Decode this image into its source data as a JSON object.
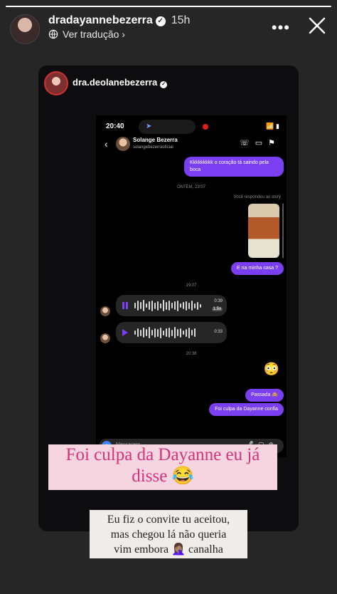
{
  "story": {
    "progress": 1.0,
    "username": "dradayannebezerra",
    "time": "15h",
    "translate_label": "Ver tradução",
    "more_icon": "more-dots-icon",
    "close_icon": "close-icon"
  },
  "repost": {
    "username": "dra.deolanebezerra"
  },
  "phone": {
    "status_time": "20:40",
    "contact_name": "Solange Bezerra",
    "contact_handle": "solangebezerraoficial",
    "messages": {
      "m1": "Kkkkkkkkk o coração tá saindo pela boca",
      "stamp1": "ONTEM, 23:07",
      "replied": "Você respondeu ao story",
      "m2": "E na minha casa ?",
      "stamp2": "19:07",
      "audio1_duration": "0:39",
      "audio1_speed": "1.5x",
      "audio2_duration": "0:33",
      "stamp3": "20:38",
      "emoji": "😳",
      "m3": "Passada 🙈",
      "m4": "Foi culpa da Dayanne confia"
    },
    "composer_placeholder": "Mensagem..."
  },
  "captions": {
    "main_line1": "Foi culpa da Dayanne eu já",
    "main_line2": "disse 😂",
    "second_line1": "Eu fiz o convite tu aceitou,",
    "second_line2": "mas chegou lá  não queria",
    "second_line3": "vim embora 🤦🏽‍♀️ canalha"
  }
}
